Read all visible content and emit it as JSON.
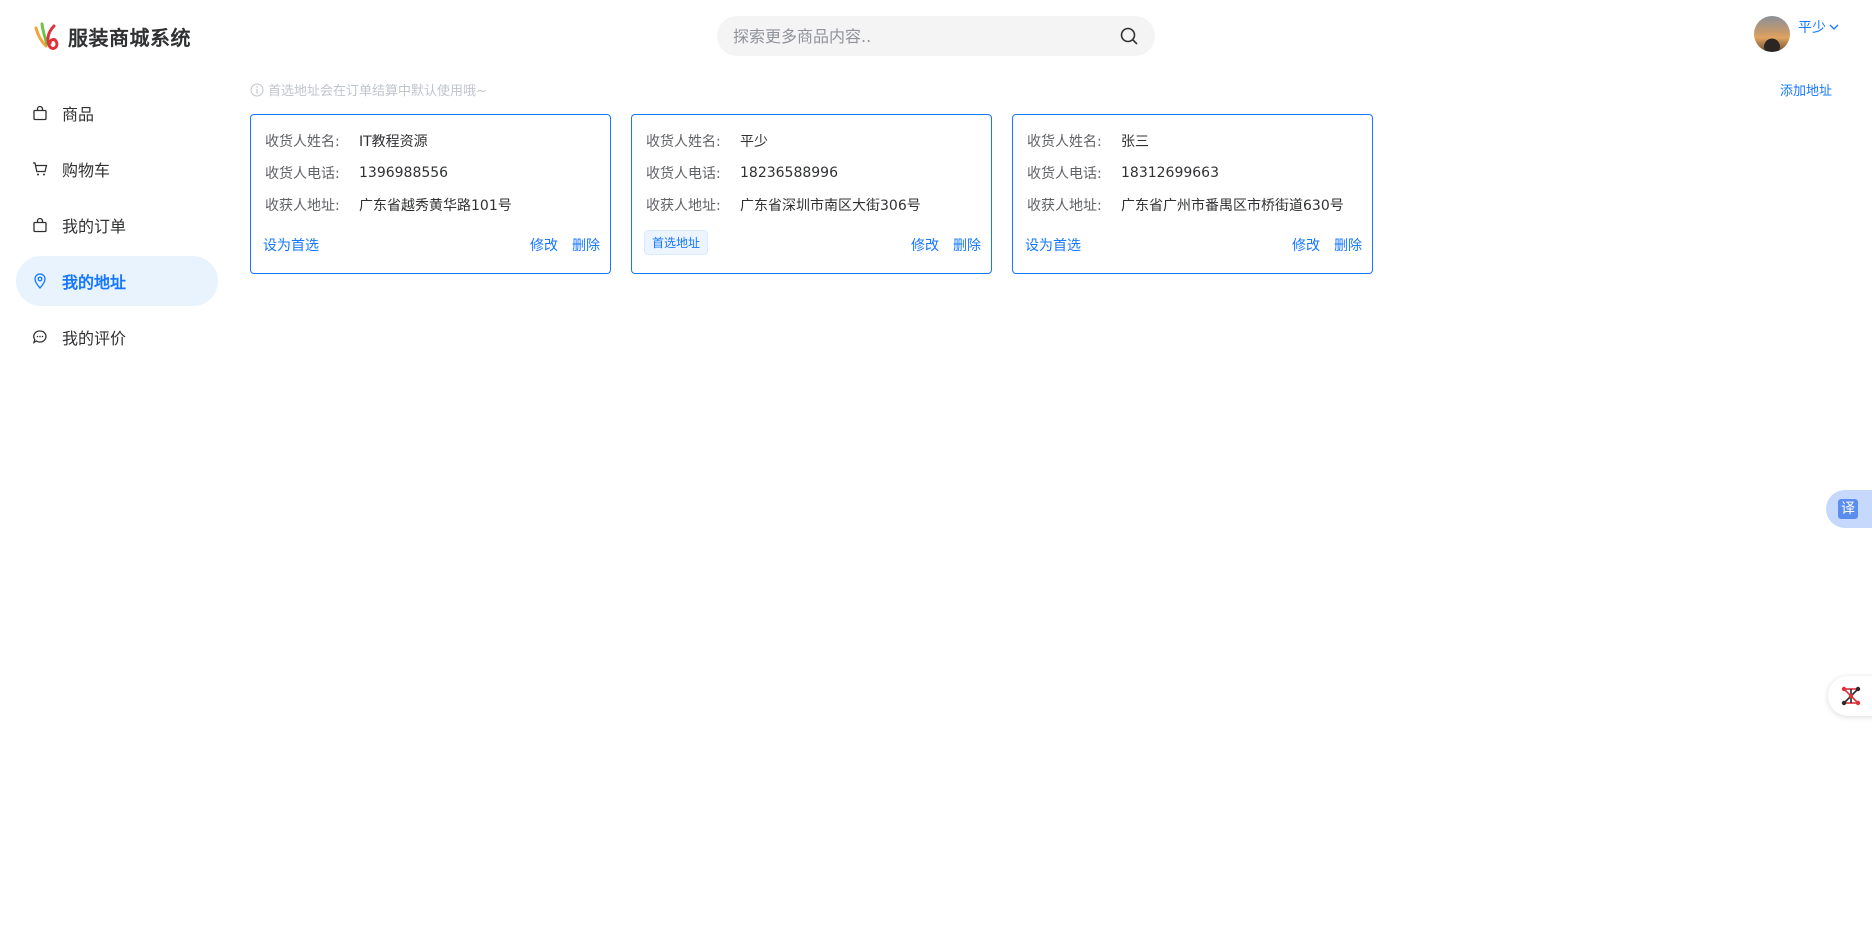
{
  "app": {
    "title": "服装商城系统"
  },
  "search": {
    "placeholder": "探索更多商品内容.."
  },
  "user": {
    "name": "平少"
  },
  "sidebar": {
    "items": [
      {
        "label": "商品",
        "icon": "shopping-bag-icon",
        "active": false
      },
      {
        "label": "购物车",
        "icon": "cart-icon",
        "active": false
      },
      {
        "label": "我的订单",
        "icon": "shopping-bag-icon",
        "active": false
      },
      {
        "label": "我的地址",
        "icon": "location-pin-icon",
        "active": true
      },
      {
        "label": "我的评价",
        "icon": "chat-bubble-icon",
        "active": false
      }
    ]
  },
  "main": {
    "tip": "首选地址会在订单结算中默认使用哦~",
    "add_address": "添加地址",
    "labels": {
      "name": "收货人姓名:",
      "phone": "收货人电话:",
      "address": "收获人地址:"
    },
    "actions": {
      "set_preferred": "设为首选",
      "edit": "修改",
      "delete": "删除",
      "preferred_tag": "首选地址"
    },
    "addresses": [
      {
        "name": "IT教程资源",
        "phone": "1396988556",
        "address": "广东省越秀黄华路101号",
        "preferred": false
      },
      {
        "name": "平少",
        "phone": "18236588996",
        "address": "广东省深圳市南区大街306号",
        "preferred": true
      },
      {
        "name": "张三",
        "phone": "18312699663",
        "address": "广东省广州市番禺区市桥街道630号",
        "preferred": false
      }
    ]
  },
  "widgets": {
    "translate_label": "译"
  },
  "colors": {
    "accent": "#1677ff",
    "active_bg": "#e8f3fe",
    "tip": "#c0c4cc"
  }
}
